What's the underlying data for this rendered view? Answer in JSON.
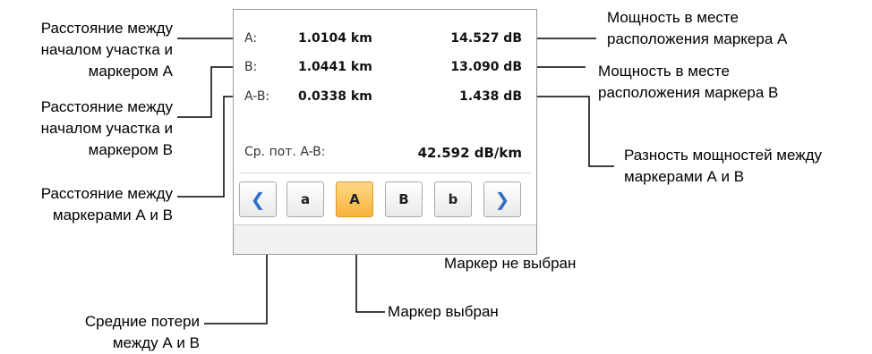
{
  "panel": {
    "rows": [
      {
        "label": "A:",
        "distance": "1.0104 km",
        "power": "14.527 dB"
      },
      {
        "label": "B:",
        "distance": "1.0441 km",
        "power": "13.090 dB"
      },
      {
        "label": "A-B:",
        "distance": "0.0338 km",
        "power": "1.438 dB"
      }
    ],
    "avg_label": "Ср. пот. A-B:",
    "avg_value": "42.592 dB/km",
    "buttons": {
      "prev": "❮",
      "marker_a_small": "a",
      "marker_a": "A",
      "marker_b": "B",
      "marker_b_small": "b",
      "next": "❯"
    }
  },
  "callouts": {
    "dist_a": [
      "Расстояние между",
      "началом участка и",
      "маркером А"
    ],
    "dist_b": [
      "Расстояние между",
      "началом участка и",
      "маркером В"
    ],
    "dist_ab": [
      "Расстояние между",
      "маркерами А и В"
    ],
    "avg_loss": [
      "Средние потери",
      "между А и В"
    ],
    "power_a": [
      "Мощность в месте",
      "расположения маркера А"
    ],
    "power_b": [
      "Мощность в месте",
      "расположения маркера В"
    ],
    "power_diff": [
      "Разность мощностей между",
      "маркерами А и В"
    ],
    "not_selected": "Маркер не выбран",
    "selected": "Маркер выбран"
  }
}
